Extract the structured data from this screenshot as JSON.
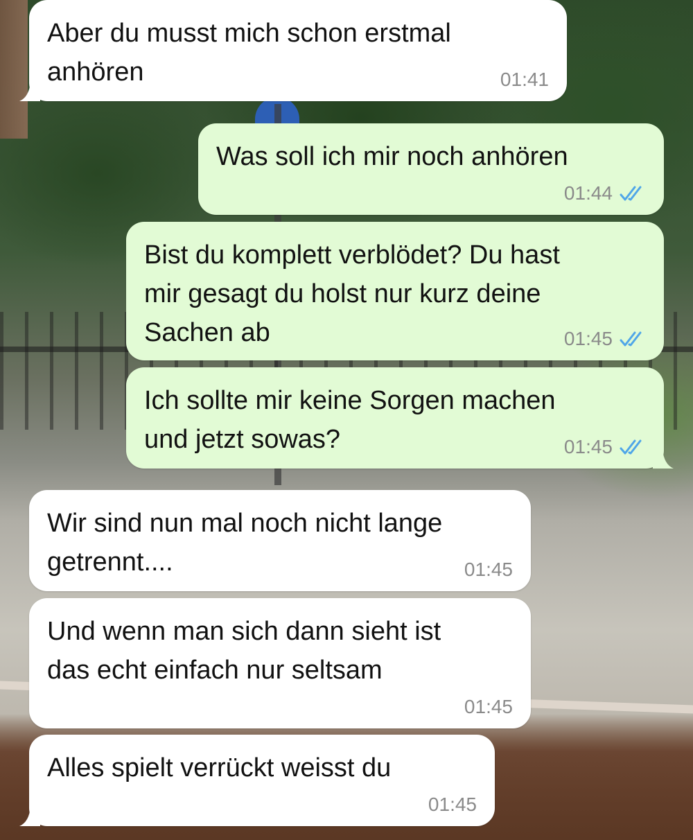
{
  "messages": [
    {
      "direction": "incoming",
      "text": "Aber du musst mich schon erstmal\nanhören",
      "time": "01:41"
    },
    {
      "direction": "outgoing",
      "text": "Was soll ich mir noch anhören",
      "time": "01:44",
      "status": "read"
    },
    {
      "direction": "outgoing",
      "text": "Bist du komplett verblödet? Du hast\nmir gesagt du holst nur kurz deine\nSachen ab",
      "time": "01:45",
      "status": "read"
    },
    {
      "direction": "outgoing",
      "text": "Ich sollte mir keine Sorgen machen\nund jetzt sowas?",
      "time": "01:45",
      "status": "read"
    },
    {
      "direction": "incoming",
      "text": "Wir sind nun mal noch nicht lange\ngetrennt....",
      "time": "01:45"
    },
    {
      "direction": "incoming",
      "text": "Und wenn man sich dann sieht ist\ndas echt einfach nur seltsam",
      "time": "01:45"
    },
    {
      "direction": "incoming",
      "text": "Alles spielt verrückt weisst du",
      "time": "01:45"
    }
  ],
  "colors": {
    "incoming_bubble": "#ffffff",
    "outgoing_bubble": "#e2fbd5",
    "read_check": "#4fa6e8",
    "timestamp": "#8a8a8a"
  },
  "icons": {
    "read_status": "double-check-icon"
  }
}
